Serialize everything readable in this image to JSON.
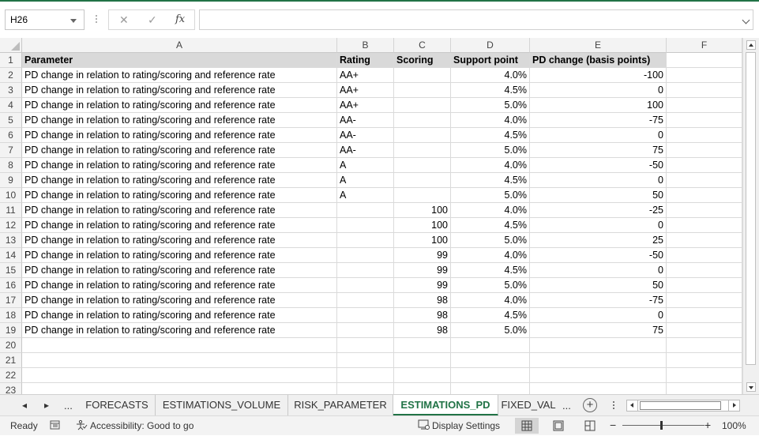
{
  "formula_bar": {
    "name_box": "H26",
    "cancel_icon": "x-icon",
    "enter_icon": "checkmark-icon",
    "function_label": "fx",
    "formula_value": ""
  },
  "columns": [
    "A",
    "B",
    "C",
    "D",
    "E",
    "F"
  ],
  "rows": [
    {
      "n": "1",
      "a": "Parameter",
      "b": "Rating",
      "c": "Scoring",
      "d": "Support point",
      "e": "PD change (basis points)"
    },
    {
      "n": "2",
      "a": "PD change in relation to rating/scoring and reference rate",
      "b": "AA+",
      "c": "",
      "d": "4.0%",
      "e": "-100"
    },
    {
      "n": "3",
      "a": "PD change in relation to rating/scoring and reference rate",
      "b": "AA+",
      "c": "",
      "d": "4.5%",
      "e": "0"
    },
    {
      "n": "4",
      "a": "PD change in relation to rating/scoring and reference rate",
      "b": "AA+",
      "c": "",
      "d": "5.0%",
      "e": "100"
    },
    {
      "n": "5",
      "a": "PD change in relation to rating/scoring and reference rate",
      "b": "AA-",
      "c": "",
      "d": "4.0%",
      "e": "-75"
    },
    {
      "n": "6",
      "a": "PD change in relation to rating/scoring and reference rate",
      "b": "AA-",
      "c": "",
      "d": "4.5%",
      "e": "0"
    },
    {
      "n": "7",
      "a": "PD change in relation to rating/scoring and reference rate",
      "b": "AA-",
      "c": "",
      "d": "5.0%",
      "e": "75"
    },
    {
      "n": "8",
      "a": "PD change in relation to rating/scoring and reference rate",
      "b": "A",
      "c": "",
      "d": "4.0%",
      "e": "-50"
    },
    {
      "n": "9",
      "a": "PD change in relation to rating/scoring and reference rate",
      "b": "A",
      "c": "",
      "d": "4.5%",
      "e": "0"
    },
    {
      "n": "10",
      "a": "PD change in relation to rating/scoring and reference rate",
      "b": "A",
      "c": "",
      "d": "5.0%",
      "e": "50"
    },
    {
      "n": "11",
      "a": "PD change in relation to rating/scoring and reference rate",
      "b": "",
      "c": "100",
      "d": "4.0%",
      "e": "-25"
    },
    {
      "n": "12",
      "a": "PD change in relation to rating/scoring and reference rate",
      "b": "",
      "c": "100",
      "d": "4.5%",
      "e": "0"
    },
    {
      "n": "13",
      "a": "PD change in relation to rating/scoring and reference rate",
      "b": "",
      "c": "100",
      "d": "5.0%",
      "e": "25"
    },
    {
      "n": "14",
      "a": "PD change in relation to rating/scoring and reference rate",
      "b": "",
      "c": "99",
      "d": "4.0%",
      "e": "-50"
    },
    {
      "n": "15",
      "a": "PD change in relation to rating/scoring and reference rate",
      "b": "",
      "c": "99",
      "d": "4.5%",
      "e": "0"
    },
    {
      "n": "16",
      "a": "PD change in relation to rating/scoring and reference rate",
      "b": "",
      "c": "99",
      "d": "5.0%",
      "e": "50"
    },
    {
      "n": "17",
      "a": "PD change in relation to rating/scoring and reference rate",
      "b": "",
      "c": "98",
      "d": "4.0%",
      "e": "-75"
    },
    {
      "n": "18",
      "a": "PD change in relation to rating/scoring and reference rate",
      "b": "",
      "c": "98",
      "d": "4.5%",
      "e": "0"
    },
    {
      "n": "19",
      "a": "PD change in relation to rating/scoring and reference rate",
      "b": "",
      "c": "98",
      "d": "5.0%",
      "e": "75"
    },
    {
      "n": "20",
      "a": "",
      "b": "",
      "c": "",
      "d": "",
      "e": ""
    },
    {
      "n": "21",
      "a": "",
      "b": "",
      "c": "",
      "d": "",
      "e": ""
    },
    {
      "n": "22",
      "a": "",
      "b": "",
      "c": "",
      "d": "",
      "e": ""
    },
    {
      "n": "23",
      "a": "",
      "b": "",
      "c": "",
      "d": "",
      "e": ""
    }
  ],
  "sheet_tabs": {
    "prev_label": "◂",
    "next_label": "▸",
    "more_left": "...",
    "tabs": [
      {
        "label": "FORECASTS",
        "active": false
      },
      {
        "label": "ESTIMATIONS_VOLUME",
        "active": false
      },
      {
        "label": "RISK_PARAMETER",
        "active": false
      },
      {
        "label": "ESTIMATIONS_PD",
        "active": true
      },
      {
        "label": "FIXED_VAL",
        "active": false
      }
    ],
    "more_right": "...",
    "add_label": "+"
  },
  "status_bar": {
    "ready": "Ready",
    "accessibility": "Accessibility: Good to go",
    "display_settings": "Display Settings",
    "zoom_minus": "−",
    "zoom_plus": "+",
    "zoom_level": "100%"
  },
  "colors": {
    "accent": "#217346",
    "header_fill": "#d9d9d9"
  }
}
